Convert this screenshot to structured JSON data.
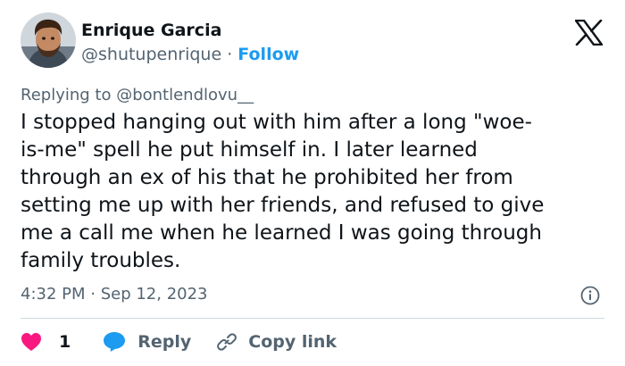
{
  "author": {
    "name": "Enrique Garcia",
    "handle": "@shutupenrique",
    "separator": "·",
    "follow_label": "Follow"
  },
  "brand_icon": "x-logo-icon",
  "reply_to": "Replying to @bontlendlovu__",
  "body_lines": [
    "I stopped hanging out with him after a long \"woe-",
    "is-me\" spell he put himself in. I later learned",
    "through an ex of his that he prohibited her from",
    "setting me up with her friends, and refused to give",
    "me a call me when he learned I was going through",
    "family troubles."
  ],
  "timestamp": "4:32 PM · Sep 12, 2023",
  "actions": {
    "like_count": "1",
    "reply_label": "Reply",
    "copy_label": "Copy link"
  },
  "colors": {
    "accent": "#1d9bf0",
    "like": "#f91880",
    "secondary_text": "#536471",
    "primary_text": "#0f1419",
    "divider": "#cfd9de"
  }
}
